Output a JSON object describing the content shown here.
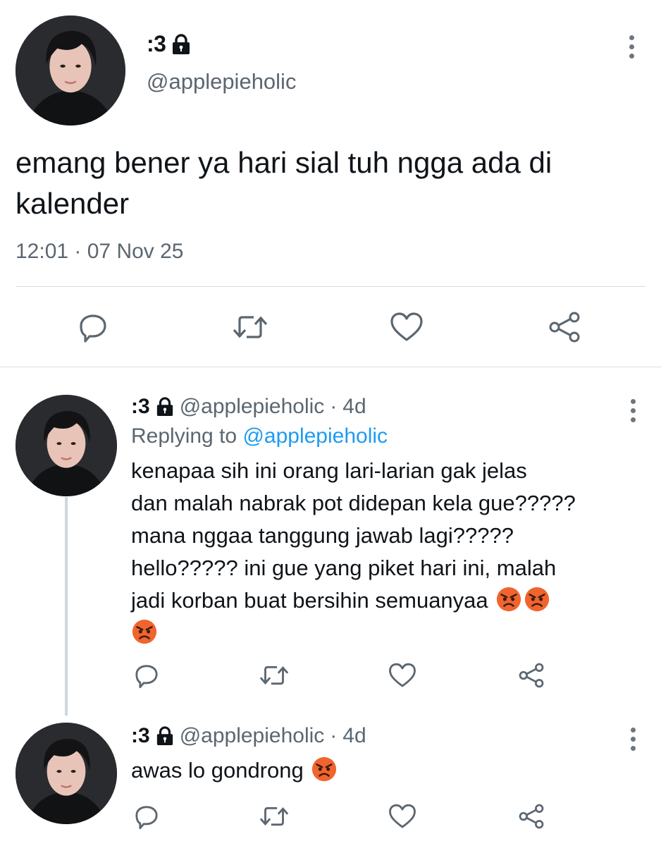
{
  "main_tweet": {
    "display_name": ":3",
    "handle": "@applepieholic",
    "text": "emang bener ya hari sial tuh ngga ada di kalender",
    "timestamp": "12:01 · 07 Nov 25",
    "actions": [
      "reply-icon",
      "retweet-icon",
      "like-icon",
      "share-icon"
    ]
  },
  "replies": [
    {
      "display_name": ":3",
      "handle": "@applepieholic",
      "separator": "·",
      "age": "4d",
      "replying_prefix": "Replying to",
      "replying_to": "@applepieholic",
      "lines": [
        "kenapaa sih ini orang lari-larian gak jelas",
        "dan malah nabrak pot didepan kela gue?????",
        "mana nggaa tanggung jawab lagi?????",
        "hello????? ini gue yang piket hari ini, malah",
        "jadi korban buat bersihin semuanyaa"
      ],
      "emojis": [
        "angry-face",
        "angry-face",
        "angry-face"
      ]
    },
    {
      "display_name": ":3",
      "handle": "@applepieholic",
      "separator": "·",
      "age": "4d",
      "text": "awas lo gondrong",
      "emojis": [
        "angry-face"
      ]
    }
  ],
  "colors": {
    "text": "#0f1419",
    "secondary": "#5b6670",
    "link": "#1d9bf0",
    "divider": "#d7dce0",
    "emoji": "#f0642e"
  }
}
